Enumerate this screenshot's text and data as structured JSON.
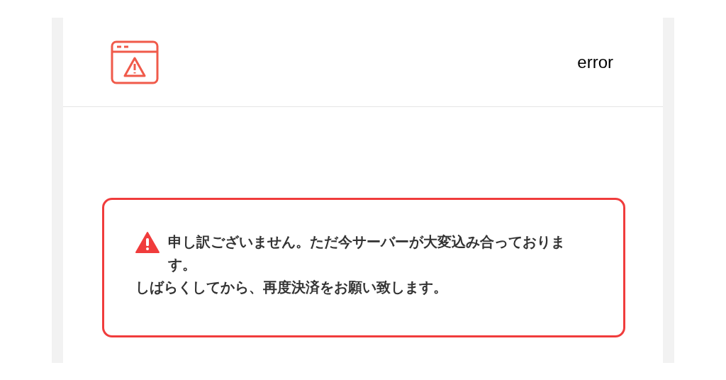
{
  "header": {
    "title": "error"
  },
  "alert": {
    "lines": [
      "申し訳ございません。ただ今サーバーが大変込み合っております。",
      "しばらくしてから、再度決済をお願い致します。"
    ]
  }
}
